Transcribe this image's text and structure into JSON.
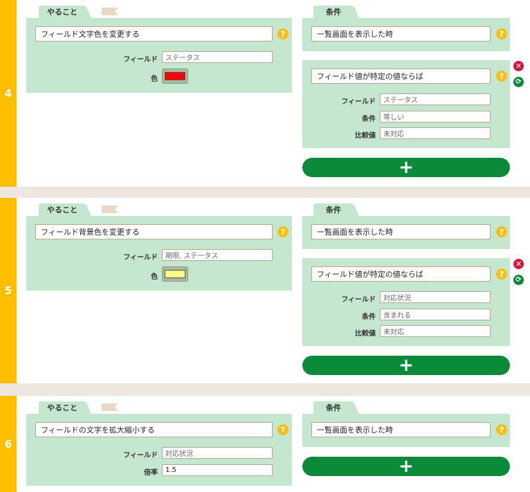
{
  "rule_4": {
    "number": "4",
    "action_tab": "やること",
    "action": "フィールド文字色を変更する",
    "field_label": "フィールド",
    "field_value": "ステータス",
    "color_label": "色",
    "color_swatch": "#ff0000",
    "cond_tab": "条件",
    "cond1": "一覧画面を表示した時",
    "cond2": "フィールド値が特定の値ならば",
    "cf_field_label": "フィールド",
    "cf_field_value": "ステータス",
    "cf_cond_label": "条件",
    "cf_cond_value": "等しい",
    "cf_compare_label": "比較値",
    "cf_compare_value": "未対応",
    "add": "+"
  },
  "rule_5": {
    "number": "5",
    "action_tab": "やること",
    "action": "フィールド背景色を変更する",
    "field_label": "フィールド",
    "field_value": "期限, ステータス",
    "color_label": "色",
    "color_swatch": "#ffff88",
    "cond_tab": "条件",
    "cond1": "一覧画面を表示した時",
    "cond2": "フィールド値が特定の値ならば",
    "cf_field_label": "フィールド",
    "cf_field_value": "対応状況",
    "cf_cond_label": "条件",
    "cf_cond_value": "含まれる",
    "cf_compare_label": "比較値",
    "cf_compare_value": "未対応",
    "add": "+"
  },
  "rule_6": {
    "number": "6",
    "action_tab": "やること",
    "action": "フィールドの文字を拡大縮小する",
    "field_label": "フィールド",
    "field_value": "対応状況",
    "rate_label": "倍率",
    "rate_value": "1.5",
    "cond_tab": "条件",
    "cond1": "一覧画面を表示した時",
    "add": "+"
  },
  "help_icon": "?",
  "delete_icon": "✕",
  "refresh_icon": "⟳"
}
